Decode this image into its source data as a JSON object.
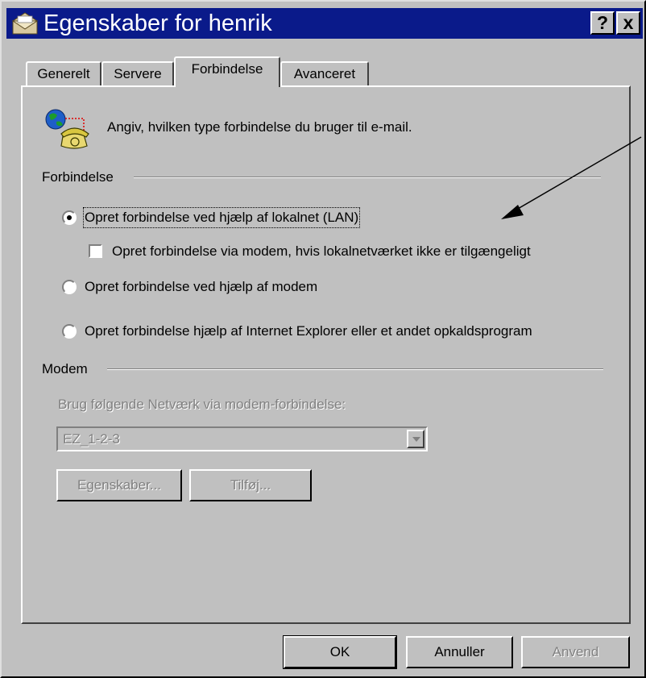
{
  "window": {
    "title": "Egenskaber for henrik",
    "help_label": "?",
    "close_label": "x"
  },
  "tabs": [
    {
      "label": "Generelt",
      "active": false
    },
    {
      "label": "Servere",
      "active": false
    },
    {
      "label": "Forbindelse",
      "active": true
    },
    {
      "label": "Avanceret",
      "active": false
    }
  ],
  "intro": {
    "icon": "globe-phone-icon",
    "text": "Angiv, hvilken type forbindelse du bruger til e-mail."
  },
  "connection": {
    "group_label": "Forbindelse",
    "options": [
      {
        "label": "Opret forbindelse ved hjælp af lokalnet (LAN)",
        "selected": true
      },
      {
        "label": "Opret forbindelse ved hjælp af modem",
        "selected": false
      },
      {
        "label": "Opret forbindelse hjælp af Internet Explorer eller et andet opkaldsprogram",
        "selected": false
      }
    ],
    "modem_fallback": {
      "label": "Opret forbindelse via modem, hvis lokalnetværket ikke er tilgængeligt",
      "checked": false
    }
  },
  "modem": {
    "group_label": "Modem",
    "network_label": "Brug følgende Netværk via modem-forbindelse:",
    "network_value": "EZ_1-2-3",
    "properties_label": "Egenskaber...",
    "add_label": "Tilføj..."
  },
  "footer": {
    "ok_label": "OK",
    "cancel_label": "Annuller",
    "apply_label": "Anvend"
  },
  "colors": {
    "titlebar": "#0a1a8a",
    "face": "#c0c0c0",
    "disabled_text": "#808080"
  }
}
